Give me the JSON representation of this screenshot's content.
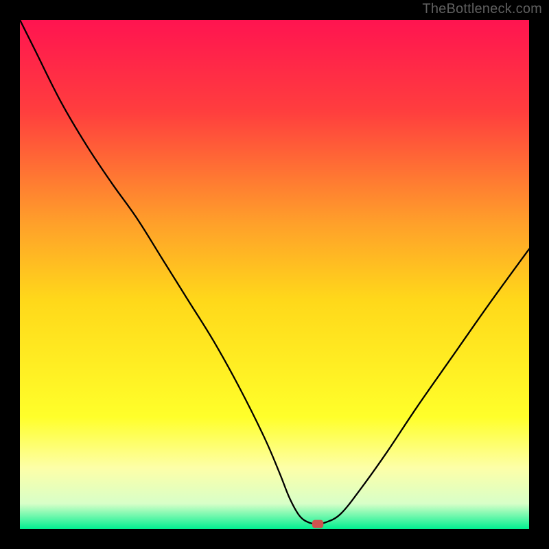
{
  "attribution": "TheBottleneck.com",
  "chart_data": {
    "type": "line",
    "title": "",
    "xlabel": "",
    "ylabel": "",
    "xlim": [
      0,
      100
    ],
    "ylim": [
      0,
      100
    ],
    "grid": false,
    "background": {
      "type": "vertical-gradient",
      "stops": [
        {
          "pos": 0.0,
          "color": "#ff1450"
        },
        {
          "pos": 0.18,
          "color": "#ff3e3e"
        },
        {
          "pos": 0.4,
          "color": "#ffa02a"
        },
        {
          "pos": 0.55,
          "color": "#ffd81a"
        },
        {
          "pos": 0.78,
          "color": "#ffff2a"
        },
        {
          "pos": 0.88,
          "color": "#fdffa8"
        },
        {
          "pos": 0.95,
          "color": "#d8ffc8"
        },
        {
          "pos": 1.0,
          "color": "#00f090"
        }
      ]
    },
    "series": [
      {
        "name": "bottleneck-curve",
        "color": "#000000",
        "width": 2.3,
        "x": [
          0.0,
          3.0,
          8.0,
          13.0,
          18.0,
          23.0,
          28.0,
          33.0,
          38.0,
          43.0,
          48.0,
          51.0,
          53.0,
          55.0,
          57.0,
          58.5,
          60.0,
          63.0,
          67.0,
          72.0,
          78.0,
          85.0,
          92.0,
          100.0
        ],
        "y": [
          100.0,
          94.0,
          84.0,
          75.5,
          68.0,
          61.0,
          53.0,
          45.0,
          37.0,
          28.0,
          18.0,
          11.0,
          6.0,
          2.5,
          1.2,
          1.1,
          1.3,
          3.0,
          8.0,
          15.0,
          24.0,
          34.0,
          44.0,
          55.0
        ]
      }
    ],
    "markers": [
      {
        "name": "optimal-point",
        "shape": "rounded-rect",
        "cx": 58.5,
        "cy": 1.0,
        "w": 2.2,
        "h": 1.6,
        "color": "#cf534f"
      }
    ]
  }
}
